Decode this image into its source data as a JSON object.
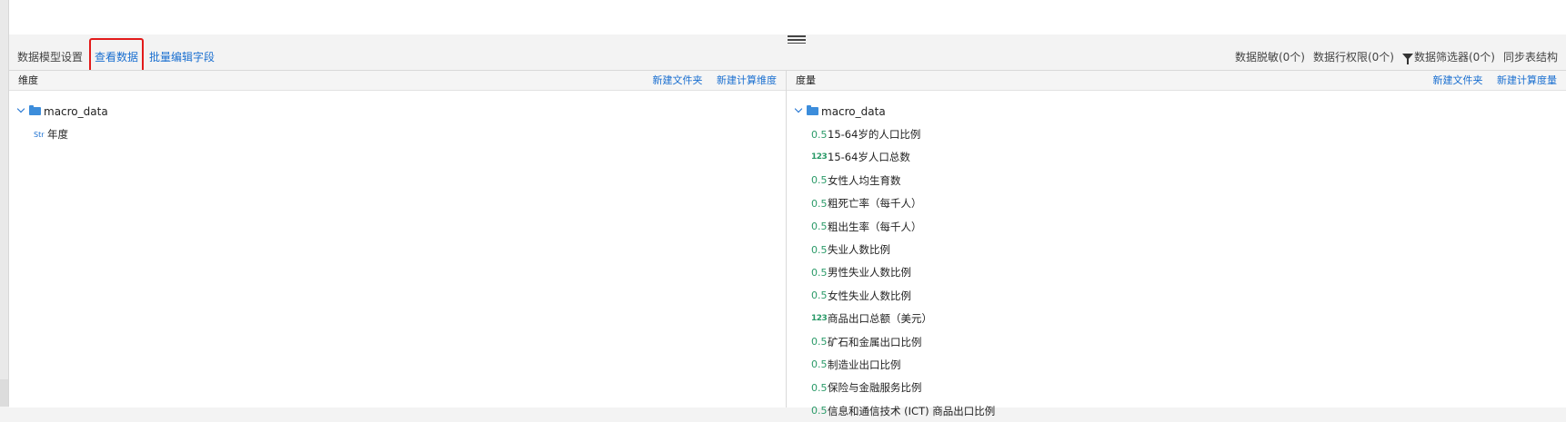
{
  "toolbar": {
    "tabs": [
      {
        "label": "数据模型设置",
        "active": false
      },
      {
        "label": "查看数据",
        "active": true
      },
      {
        "label": "批量编辑字段",
        "active": false
      }
    ],
    "right_items": [
      {
        "label": "数据脱敏(0个)"
      },
      {
        "label": "数据行权限(0个)"
      },
      {
        "label": "数据筛选器(0个)",
        "icon": "filter-icon"
      },
      {
        "label": "同步表结构"
      }
    ]
  },
  "dimension_panel": {
    "title": "维度",
    "actions": [
      "新建文件夹",
      "新建计算维度"
    ],
    "folder": "macro_data",
    "fields": [
      {
        "type": "Str",
        "name": "年度"
      }
    ]
  },
  "measure_panel": {
    "title": "度量",
    "actions": [
      "新建文件夹",
      "新建计算度量"
    ],
    "folder": "macro_data",
    "fields": [
      {
        "type": "0.5",
        "name": "15-64岁的人口比例"
      },
      {
        "type": "123",
        "name": "15-64岁人口总数"
      },
      {
        "type": "0.5",
        "name": "女性人均生育数"
      },
      {
        "type": "0.5",
        "name": "粗死亡率（每千人）"
      },
      {
        "type": "0.5",
        "name": "粗出生率（每千人）"
      },
      {
        "type": "0.5",
        "name": "失业人数比例"
      },
      {
        "type": "0.5",
        "name": "男性失业人数比例"
      },
      {
        "type": "0.5",
        "name": "女性失业人数比例"
      },
      {
        "type": "123",
        "name": "商品出口总额（美元）"
      },
      {
        "type": "0.5",
        "name": "矿石和金属出口比例"
      },
      {
        "type": "0.5",
        "name": "制造业出口比例"
      },
      {
        "type": "0.5",
        "name": "保险与金融服务比例"
      },
      {
        "type": "0.5",
        "name": "信息和通信技术 (ICT) 商品出口比例"
      }
    ]
  }
}
